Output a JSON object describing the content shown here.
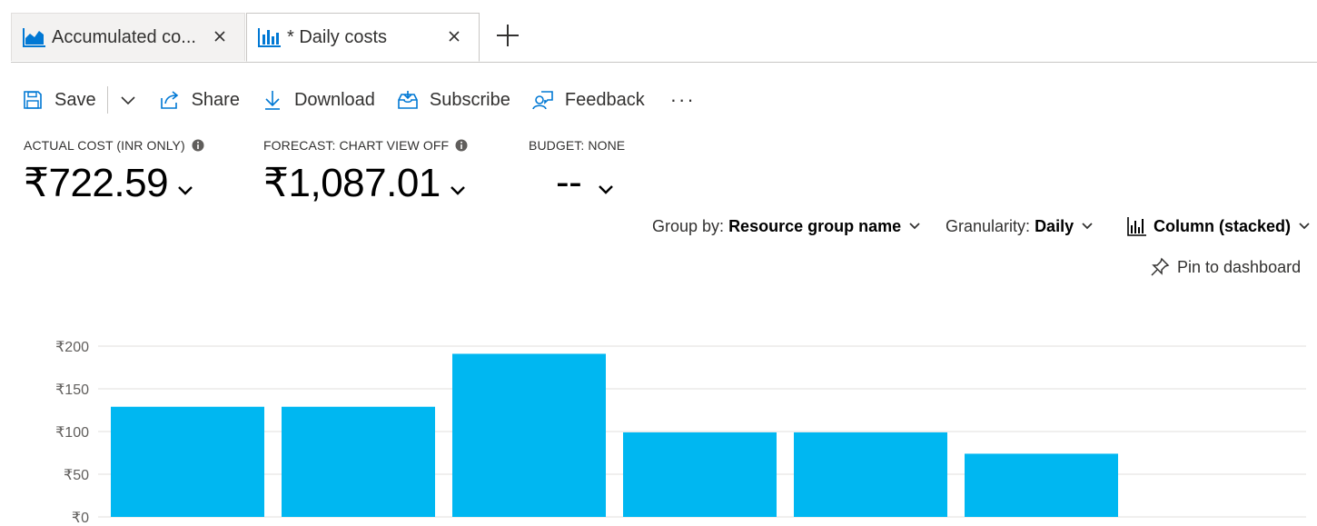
{
  "tabs": [
    {
      "label": "Accumulated co...",
      "active": false,
      "icon": "area-chart-icon"
    },
    {
      "label": "* Daily costs",
      "active": true,
      "icon": "bar-chart-icon"
    }
  ],
  "toolbar": {
    "save": "Save",
    "share": "Share",
    "download": "Download",
    "subscribe": "Subscribe",
    "feedback": "Feedback",
    "more": "···"
  },
  "kpis": {
    "actual": {
      "label": "ACTUAL COST (INR ONLY)",
      "value": "₹722.59"
    },
    "forecast": {
      "label": "FORECAST: CHART VIEW OFF",
      "value": "₹1,087.01"
    },
    "budget": {
      "label": "BUDGET: NONE",
      "value": "--"
    }
  },
  "controls": {
    "group_by_label": "Group by:",
    "group_by_value": "Resource group name",
    "granularity_label": "Granularity:",
    "granularity_value": "Daily",
    "chart_type": "Column (stacked)",
    "pin": "Pin to dashboard"
  },
  "colors": {
    "bar": "#00b7f1",
    "grid": "#e1dfdd",
    "accent": "#0078d4"
  },
  "chart_data": {
    "type": "bar",
    "categories": [
      "",
      "",
      "",
      "",
      "",
      ""
    ],
    "values": [
      129,
      129,
      191,
      99,
      99,
      74
    ],
    "yticks": [
      "₹0",
      "₹50",
      "₹100",
      "₹150",
      "₹200"
    ],
    "ytick_values": [
      0,
      50,
      100,
      150,
      200
    ],
    "ylim": [
      0,
      200
    ],
    "stacked": true,
    "grid": true
  }
}
